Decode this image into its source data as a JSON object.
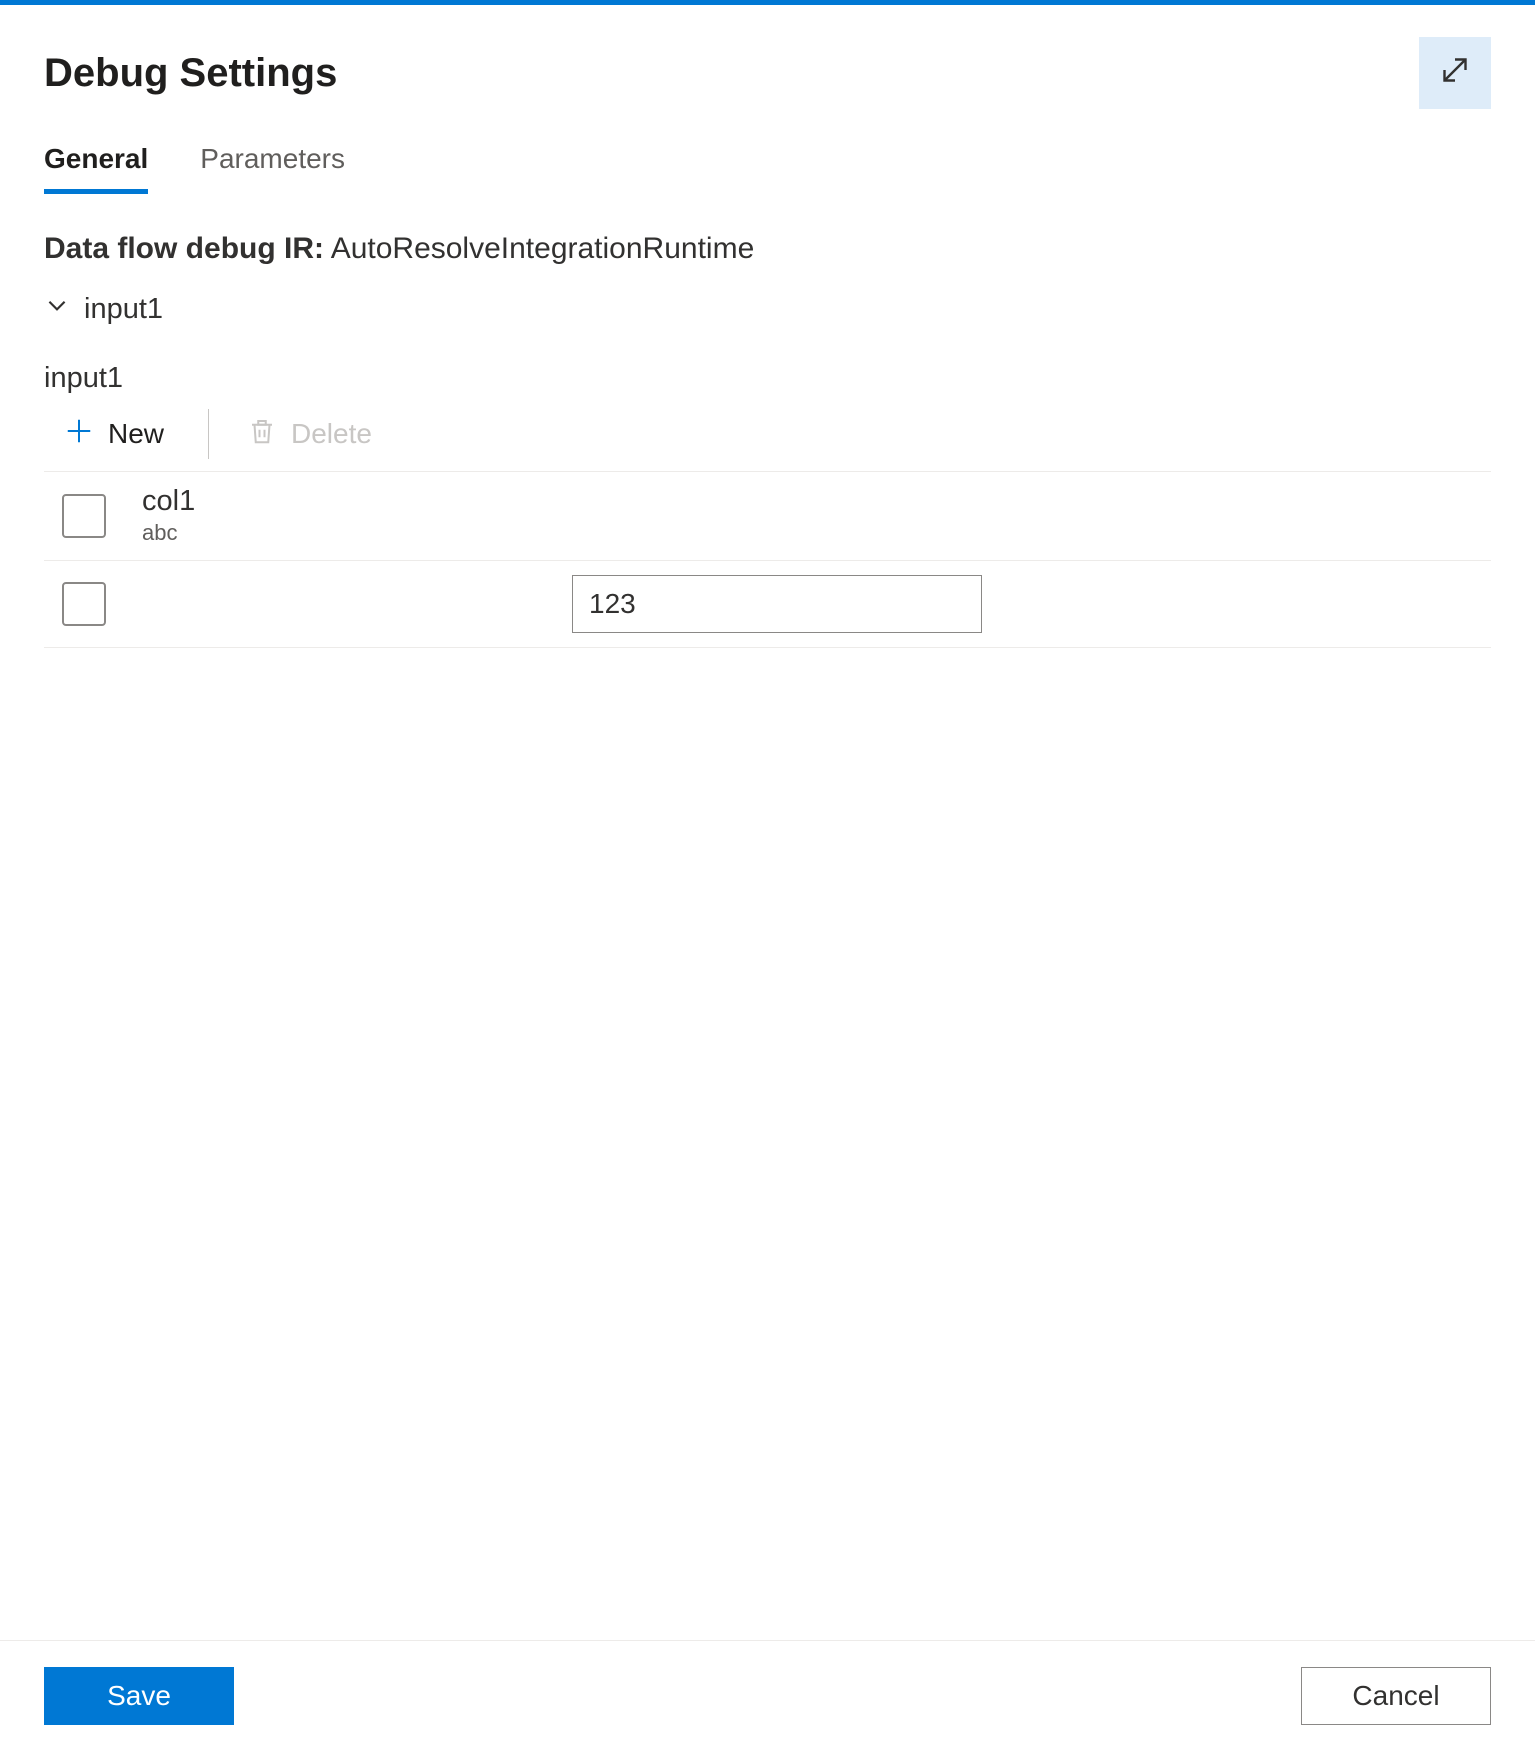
{
  "header": {
    "title": "Debug Settings"
  },
  "tabs": [
    {
      "label": "General",
      "active": true
    },
    {
      "label": "Parameters",
      "active": false
    }
  ],
  "ir": {
    "label": "Data flow debug IR:",
    "value": "AutoResolveIntegrationRuntime"
  },
  "section": {
    "collapser_label": "input1",
    "title": "input1"
  },
  "toolbar": {
    "new_label": "New",
    "delete_label": "Delete"
  },
  "table": {
    "columns": [
      {
        "name": "col1",
        "type": "abc"
      }
    ],
    "rows": [
      {
        "values": [
          "123"
        ]
      }
    ]
  },
  "footer": {
    "save_label": "Save",
    "cancel_label": "Cancel"
  }
}
